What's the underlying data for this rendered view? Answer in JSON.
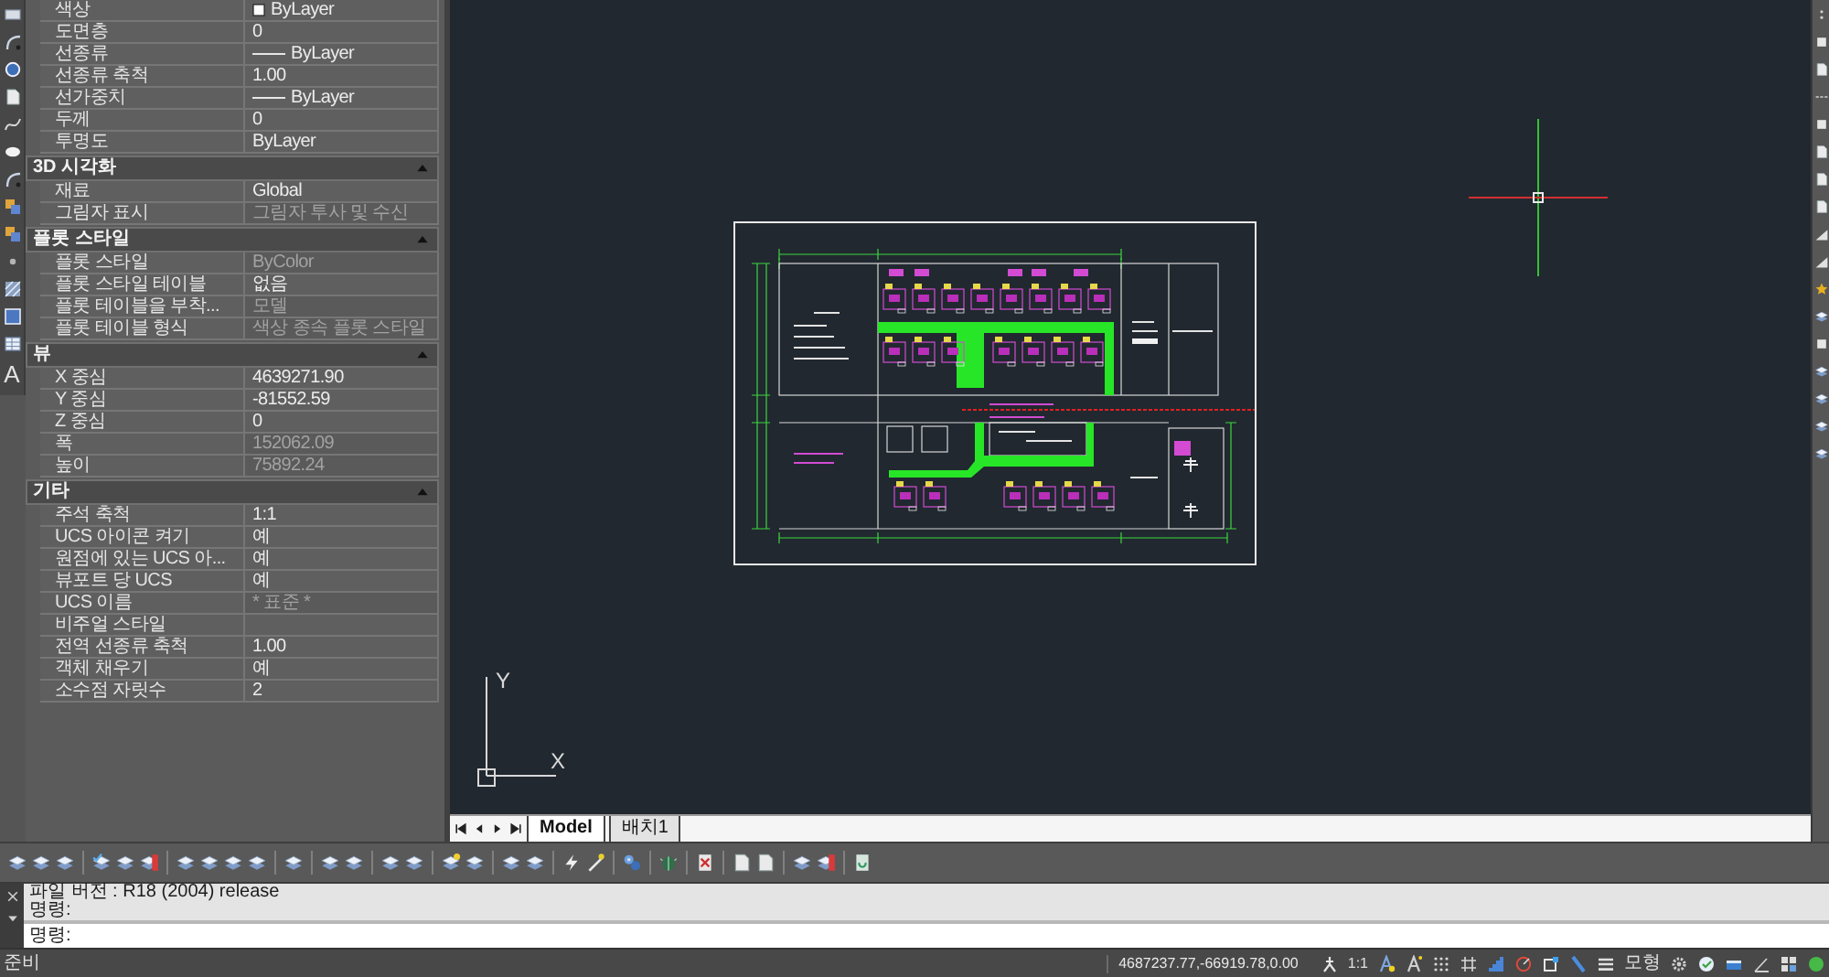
{
  "left_toolbar": {
    "text_tool": "A"
  },
  "properties": {
    "top_rows": [
      {
        "label": "색상",
        "value": "ByLayer",
        "kind": "swatch",
        "disabled": false
      },
      {
        "label": "도면층",
        "value": "0",
        "kind": "text",
        "disabled": false
      },
      {
        "label": "선종류",
        "value": "ByLayer",
        "kind": "linetype",
        "disabled": false
      },
      {
        "label": "선종류 축척",
        "value": "1.00",
        "kind": "text",
        "disabled": false
      },
      {
        "label": "선가중치",
        "value": "ByLayer",
        "kind": "linetype",
        "disabled": false
      },
      {
        "label": "두께",
        "value": "0",
        "kind": "text",
        "disabled": false
      },
      {
        "label": "투명도",
        "value": "ByLayer",
        "kind": "text",
        "disabled": false
      }
    ],
    "sections": [
      {
        "title": "3D 시각화",
        "expanded": true,
        "rows": [
          {
            "label": "재료",
            "value": "Global",
            "kind": "text",
            "disabled": false
          },
          {
            "label": "그림자 표시",
            "value": "그림자 투사 및 수신",
            "kind": "text",
            "disabled": true
          }
        ]
      },
      {
        "title": "플롯 스타일",
        "expanded": true,
        "rows": [
          {
            "label": "플롯 스타일",
            "value": "ByColor",
            "kind": "text",
            "disabled": true
          },
          {
            "label": "플롯 스타일 테이블",
            "value": "없음",
            "kind": "text",
            "disabled": false
          },
          {
            "label": "플롯 테이블을 부착...",
            "value": "모델",
            "kind": "text",
            "disabled": true
          },
          {
            "label": "플롯 테이블 형식",
            "value": "색상 종속 플롯 스타일",
            "kind": "text",
            "disabled": true
          }
        ]
      },
      {
        "title": "뷰",
        "expanded": true,
        "rows": [
          {
            "label": "X 중심",
            "value": "4639271.90",
            "kind": "text",
            "disabled": false
          },
          {
            "label": "Y 중심",
            "value": "-81552.59",
            "kind": "text",
            "disabled": false
          },
          {
            "label": "Z 중심",
            "value": "0",
            "kind": "text",
            "disabled": false
          },
          {
            "label": "폭",
            "value": "152062.09",
            "kind": "text",
            "disabled": true
          },
          {
            "label": "높이",
            "value": "75892.24",
            "kind": "text",
            "disabled": true
          }
        ]
      },
      {
        "title": "기타",
        "expanded": true,
        "rows": [
          {
            "label": "주석 축척",
            "value": "1:1",
            "kind": "text",
            "disabled": false
          },
          {
            "label": "UCS 아이콘 켜기",
            "value": "예",
            "kind": "text",
            "disabled": false
          },
          {
            "label": "원점에 있는 UCS 아...",
            "value": "예",
            "kind": "text",
            "disabled": false
          },
          {
            "label": "뷰포트 당 UCS",
            "value": "예",
            "kind": "text",
            "disabled": false
          },
          {
            "label": "UCS 이름",
            "value": "* 표준 *",
            "kind": "text",
            "disabled": true
          },
          {
            "label": "비주얼 스타일",
            "kind": "text",
            "disabled": false
          },
          {
            "label": "전역 선종류 축척",
            "value": "1.00",
            "kind": "text",
            "disabled": false
          },
          {
            "label": "객체 채우기",
            "value": "예",
            "kind": "text",
            "disabled": false
          },
          {
            "label": "소수점 자릿수",
            "value": "2",
            "kind": "text",
            "disabled": false
          }
        ]
      }
    ]
  },
  "drawing": {
    "ucs_icon": {
      "x_label": "X",
      "y_label": "Y"
    }
  },
  "layout_tabs": [
    {
      "label": "Model",
      "selected": true
    },
    {
      "label": "배치1",
      "selected": false
    }
  ],
  "command_window": {
    "history": [
      "파일 버전 : R18 (2004) release",
      "명령:"
    ],
    "prompt": "명령:"
  },
  "status_bar": {
    "message": "준비",
    "coordinates": "4687237.77,-66919.78,0.00",
    "annotation_scale": "1:1",
    "workspace_label": "모형"
  }
}
